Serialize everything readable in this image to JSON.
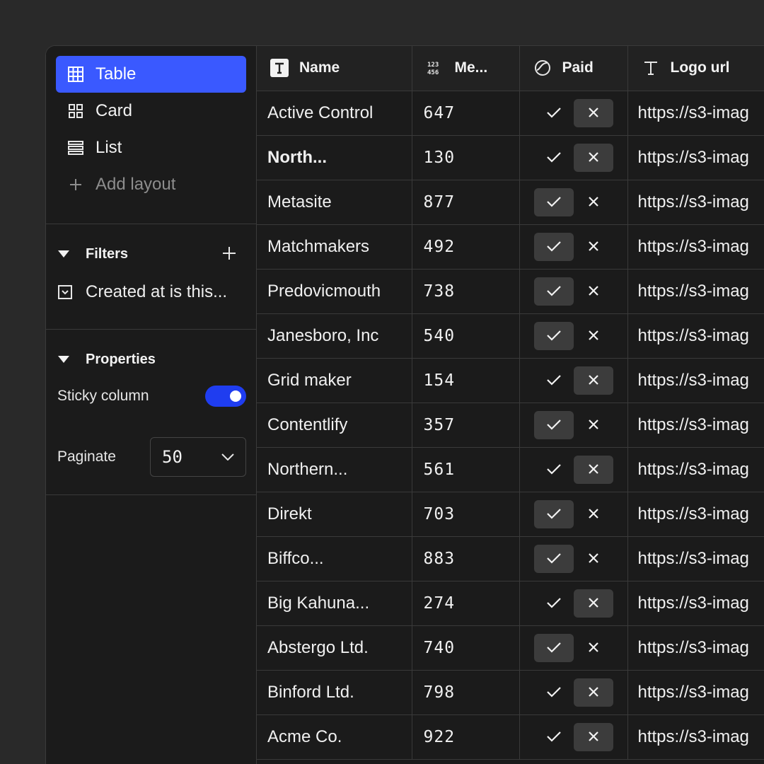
{
  "layouts": {
    "items": [
      {
        "label": "Table",
        "icon": "table-grid-icon",
        "active": true
      },
      {
        "label": "Card",
        "icon": "card-grid-icon",
        "active": false
      },
      {
        "label": "List",
        "icon": "list-icon",
        "active": false
      }
    ],
    "add_label": "Add layout"
  },
  "filters": {
    "title": "Filters",
    "items": [
      {
        "label": "Created at is this..."
      }
    ]
  },
  "properties": {
    "title": "Properties",
    "sticky_label": "Sticky column",
    "sticky_on": true,
    "paginate_label": "Paginate",
    "paginate_value": "50"
  },
  "colors": {
    "accent": "#3a59ff",
    "toggle": "#1f3df0",
    "background": "#1b1b1b"
  },
  "table": {
    "columns": [
      {
        "label": "Name",
        "icon": "text-type-icon"
      },
      {
        "label": "Me...",
        "icon": "number-type-icon"
      },
      {
        "label": "Paid",
        "icon": "boolean-type-icon"
      },
      {
        "label": "Logo url",
        "icon": "text-type-icon"
      }
    ],
    "rows": [
      {
        "name": "Active Control",
        "num": "647",
        "paid": false,
        "logo": "https://s3-imag",
        "bold": false
      },
      {
        "name": "North...",
        "num": "130",
        "paid": false,
        "logo": "https://s3-imag",
        "bold": true
      },
      {
        "name": "Metasite",
        "num": "877",
        "paid": true,
        "logo": "https://s3-imag",
        "bold": false
      },
      {
        "name": "Matchmakers",
        "num": "492",
        "paid": true,
        "logo": "https://s3-imag",
        "bold": false
      },
      {
        "name": "Predovicmouth",
        "num": "738",
        "paid": true,
        "logo": "https://s3-imag",
        "bold": false
      },
      {
        "name": "Janesboro, Inc",
        "num": "540",
        "paid": true,
        "logo": "https://s3-imag",
        "bold": false
      },
      {
        "name": "Grid maker",
        "num": "154",
        "paid": false,
        "logo": "https://s3-imag",
        "bold": false
      },
      {
        "name": "Contentlify",
        "num": "357",
        "paid": true,
        "logo": "https://s3-imag",
        "bold": false
      },
      {
        "name": "Northern...",
        "num": "561",
        "paid": false,
        "logo": "https://s3-imag",
        "bold": false
      },
      {
        "name": "Direkt",
        "num": "703",
        "paid": true,
        "logo": "https://s3-imag",
        "bold": false
      },
      {
        "name": "Biffco...",
        "num": "883",
        "paid": true,
        "logo": "https://s3-imag",
        "bold": false
      },
      {
        "name": "Big Kahuna...",
        "num": "274",
        "paid": false,
        "logo": "https://s3-imag",
        "bold": false
      },
      {
        "name": "Abstergo Ltd.",
        "num": "740",
        "paid": true,
        "logo": "https://s3-imag",
        "bold": false
      },
      {
        "name": "Binford Ltd.",
        "num": "798",
        "paid": false,
        "logo": "https://s3-imag",
        "bold": false
      },
      {
        "name": "Acme Co.",
        "num": "922",
        "paid": false,
        "logo": "https://s3-imag",
        "bold": false
      }
    ]
  }
}
